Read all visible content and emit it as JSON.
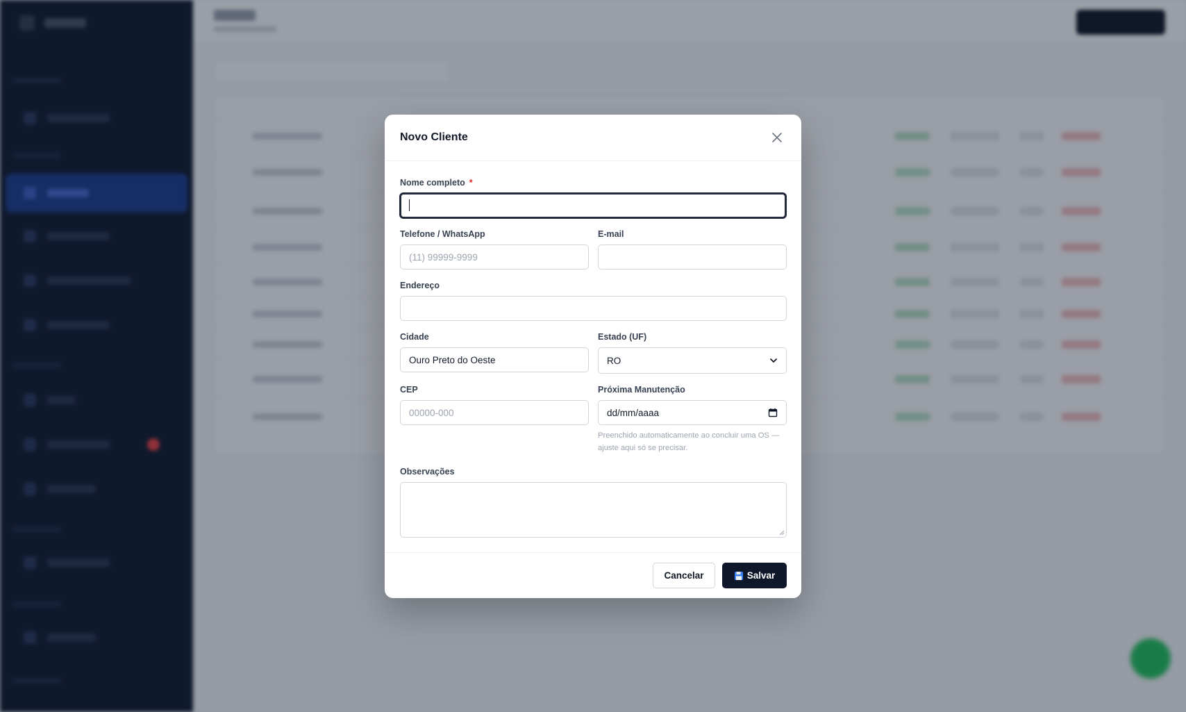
{
  "modal": {
    "title": "Novo Cliente",
    "fields": {
      "nome": {
        "label": "Nome completo",
        "required_mark": "*",
        "value": ""
      },
      "telefone": {
        "label": "Telefone / WhatsApp",
        "placeholder": "(11) 99999-9999",
        "value": ""
      },
      "email": {
        "label": "E-mail",
        "value": ""
      },
      "endereco": {
        "label": "Endereço",
        "value": ""
      },
      "cidade": {
        "label": "Cidade",
        "value": "Ouro Preto do Oeste"
      },
      "estado": {
        "label": "Estado (UF)",
        "value": "RO"
      },
      "cep": {
        "label": "CEP",
        "placeholder": "00000-000",
        "value": ""
      },
      "proxima_manutencao": {
        "label": "Próxima Manutenção",
        "value": "dd/mm/aaaa",
        "hint": "Preenchido automaticamente ao concluir uma OS — ajuste aqui só se precisar."
      },
      "observacoes": {
        "label": "Observações",
        "value": ""
      }
    },
    "buttons": {
      "cancel": "Cancelar",
      "save": "Salvar"
    }
  },
  "icons": {
    "close": "close-icon",
    "save": "floppy-disk-icon",
    "select_arrow": "chevron-down-icon",
    "calendar": "calendar-icon"
  },
  "colors": {
    "primary_button": "#0f172a",
    "overlay": "#0f172a",
    "required": "#dc2626",
    "sidebar": "#111a2e",
    "fab": "#22c55e"
  }
}
